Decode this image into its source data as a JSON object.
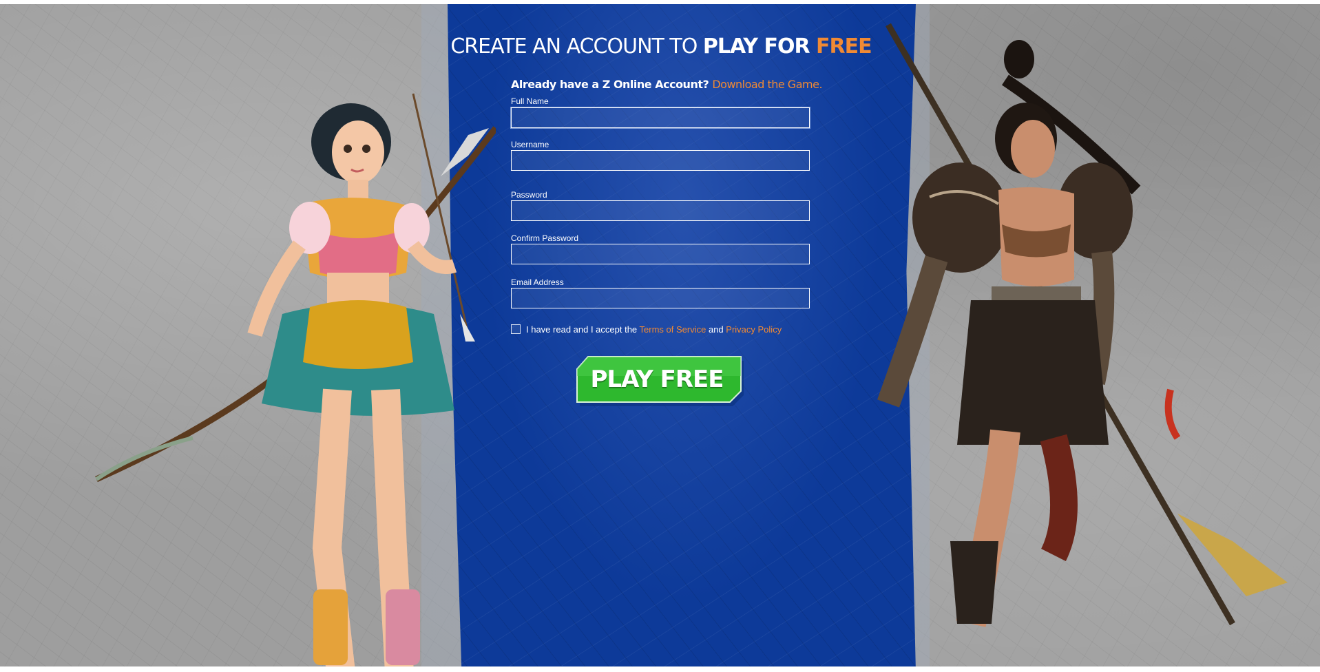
{
  "heading": {
    "part1": "CREATE AN ACCOUNT TO ",
    "part2": "PLAY FOR ",
    "part3": "FREE"
  },
  "signin": {
    "question": "Already have a Z Online Account? ",
    "link": "Download the Game."
  },
  "form": {
    "full_name_label": "Full Name",
    "full_name_value": "",
    "username_label": "Username",
    "username_value": "",
    "password_label": "Password",
    "password_value": "",
    "confirm_password_label": "Confirm Password",
    "confirm_password_value": "",
    "email_label": "Email Address",
    "email_value": ""
  },
  "terms": {
    "prefix": "I have read and I accept the ",
    "tos_link": "Terms of Service",
    "and": " and ",
    "privacy_link": "Privacy Policy",
    "checked": false
  },
  "cta": {
    "label": "PLAY FREE"
  },
  "colors": {
    "accent_orange": "#f08a34",
    "panel_blue": "#0d3a99",
    "button_green": "#2eb82e",
    "background_gray": "#9e9e9e"
  },
  "characters": {
    "left": "archer-heroine",
    "right": "spear-warrior"
  }
}
